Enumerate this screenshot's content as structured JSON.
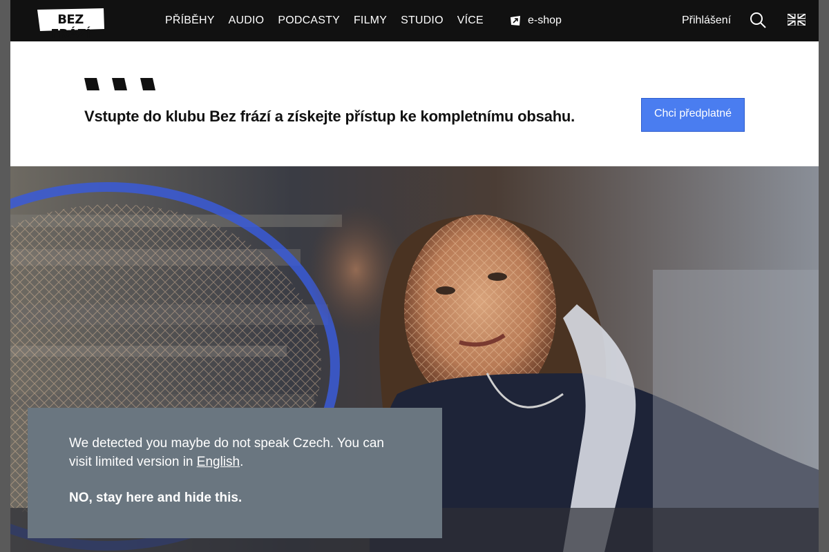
{
  "header": {
    "logo_text": "BEZ FRÁZÍ",
    "nav": [
      {
        "label": "PŘÍBĚHY"
      },
      {
        "label": "AUDIO"
      },
      {
        "label": "PODCASTY"
      },
      {
        "label": "FILMY"
      },
      {
        "label": "STUDIO"
      },
      {
        "label": "VÍCE"
      }
    ],
    "eshop_label": "e-shop",
    "login_label": "Přihlášení",
    "search_icon": "search-icon",
    "language_icon": "uk-flag-icon"
  },
  "promo": {
    "text": "Vstupte do klubu Bez frází a získejte přístup ke kompletnímu obsahu.",
    "button_label": "Chci předplatné"
  },
  "language_notice": {
    "text_before": "We detected you maybe do not speak Czech. You can visit limited version in ",
    "link_label": "English",
    "text_after": ".",
    "dismiss_label": "NO, stay here and hide this."
  },
  "colors": {
    "header_bg": "#111111",
    "accent_button": "#4a7df0",
    "notice_bg": "#6a7680"
  }
}
